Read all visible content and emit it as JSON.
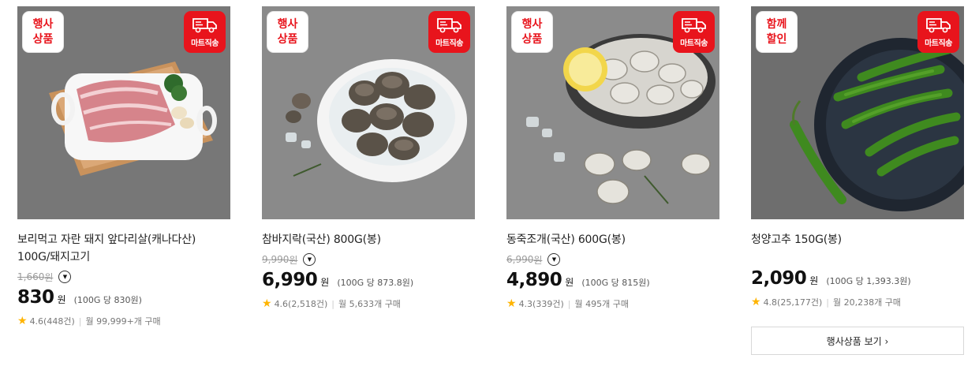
{
  "products": [
    {
      "tag": [
        "행사",
        "상품"
      ],
      "delivery_badge": "마트직송",
      "title": "보리먹고 자란 돼지 앞다리살(캐나다산) 100G/돼지고기",
      "original_price": "1,660",
      "original_won": "원",
      "price": "830",
      "won": "원",
      "unit_price": "(100G 당 830원)",
      "rating": "4.6(448건)",
      "monthly": "월 99,999+개 구매"
    },
    {
      "tag": [
        "행사",
        "상품"
      ],
      "delivery_badge": "마트직송",
      "title": "참바지락(국산) 800G(봉)",
      "original_price": "9,990",
      "original_won": "원",
      "price": "6,990",
      "won": "원",
      "unit_price": "(100G 당 873.8원)",
      "rating": "4.6(2,518건)",
      "monthly": "월 5,633개 구매"
    },
    {
      "tag": [
        "행사",
        "상품"
      ],
      "delivery_badge": "마트직송",
      "title": "동죽조개(국산) 600G(봉)",
      "original_price": "6,990",
      "original_won": "원",
      "price": "4,890",
      "won": "원",
      "unit_price": "(100G 당 815원)",
      "rating": "4.3(339건)",
      "monthly": "월 495개 구매"
    },
    {
      "tag": [
        "함께",
        "할인"
      ],
      "delivery_badge": "마트직송",
      "title": "청양고추 150G(봉)",
      "price": "2,090",
      "won": "원",
      "unit_price": "(100G 당 1,393.3원)",
      "rating": "4.8(25,177건)",
      "monthly": "월 20,238개 구매"
    }
  ],
  "more_button": "행사상품 보기 ›",
  "colors": {
    "accent": "#e8141c",
    "star": "#ffb400"
  },
  "icons": {
    "delivery": "truck-icon",
    "dropdown": "chevron-down-icon",
    "rating": "star-icon"
  }
}
